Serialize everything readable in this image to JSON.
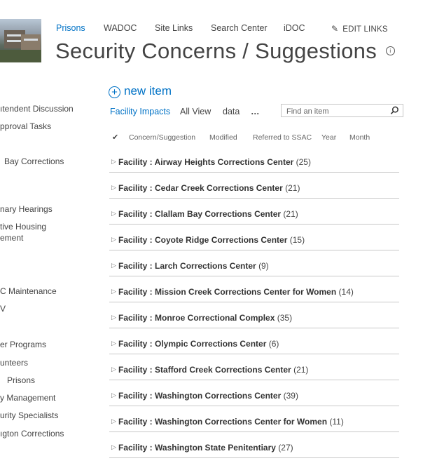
{
  "header": {
    "nav": [
      "Prisons",
      "WADOC",
      "Site Links",
      "Search Center",
      "iDOC"
    ],
    "edit_links": "EDIT LINKS",
    "title": "Security Concerns / Suggestions"
  },
  "sidebar": {
    "items": [
      "ıtendent Discussion",
      "pproval Tasks",
      "Bay Corrections",
      "nary Hearings",
      "tive Housing",
      "ement",
      "C Maintenance",
      "V",
      "er Programs",
      "unteers",
      "Prisons",
      "y Management",
      "urity Specialists",
      "ıgton Corrections"
    ]
  },
  "toolbar": {
    "new_item": "new item",
    "views": [
      "Facility Impacts",
      "All View",
      "data",
      "…"
    ],
    "search_placeholder": "Find an item"
  },
  "list": {
    "columns": [
      "Concern/Suggestion",
      "Modified",
      "Referred to SSAC",
      "Year",
      "Month"
    ],
    "group_prefix": "Facility : ",
    "groups": [
      {
        "name": "Airway Heights Corrections Center",
        "count": "(25)"
      },
      {
        "name": "Cedar Creek Corrections Center",
        "count": "(21)"
      },
      {
        "name": "Clallam Bay Corrections Center",
        "count": "(21)"
      },
      {
        "name": "Coyote Ridge Corrections Center",
        "count": "(15)"
      },
      {
        "name": "Larch Corrections Center",
        "count": "(9)"
      },
      {
        "name": "Mission Creek Corrections Center for Women",
        "count": "(14)"
      },
      {
        "name": "Monroe Correctional Complex",
        "count": "(35)"
      },
      {
        "name": "Olympic Corrections Center",
        "count": "(6)"
      },
      {
        "name": "Stafford Creek Corrections Center",
        "count": "(21)"
      },
      {
        "name": "Washington Corrections Center",
        "count": "(39)"
      },
      {
        "name": "Washington Corrections Center for Women",
        "count": "(11)"
      },
      {
        "name": "Washington State Penitentiary",
        "count": "(27)"
      }
    ]
  }
}
